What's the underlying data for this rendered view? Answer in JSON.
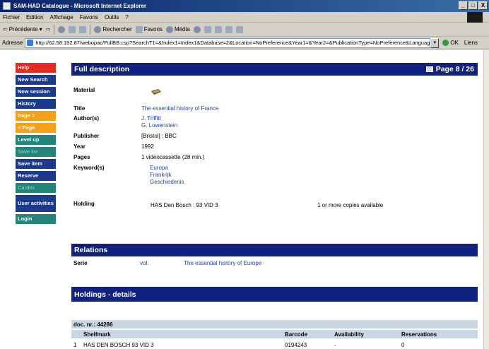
{
  "window": {
    "title": "SAM-HAD Catalogue - Microsoft Internet Explorer",
    "controls": [
      "_",
      "□",
      "X"
    ]
  },
  "menu": [
    "Fichier",
    "Edition",
    "Affichage",
    "Favoris",
    "Outils",
    "?"
  ],
  "toolbar": {
    "back": "Précédente",
    "search": "Rechercher",
    "favorites": "Favoris",
    "media": "Média"
  },
  "address": {
    "label": "Adresse",
    "url": "http://62.58.192.87/webopac/FullBB.csp?SearchT1=&Index1=Index1&Database=2&Location=NoPreference&Year1=&Year2=&PublicationType=NoPreference&Language=NoPr",
    "go": "OK",
    "links": "Liens"
  },
  "sidebar": [
    {
      "label": "Help",
      "style": "red"
    },
    {
      "label": "New Search",
      "style": "navy"
    },
    {
      "label": "New session",
      "style": "navy"
    },
    {
      "label": "History",
      "style": "navy"
    },
    {
      "label": "Page >",
      "style": "orange"
    },
    {
      "label": "< Page",
      "style": "orange"
    },
    {
      "label": "Level up",
      "style": "teal"
    },
    {
      "label": "Save list",
      "style": "teal-dim"
    },
    {
      "label": "Save item",
      "style": "navy"
    },
    {
      "label": "Reserve",
      "style": "navy"
    },
    {
      "label": "Cardex",
      "style": "teal-dim"
    },
    {
      "label": "User activities",
      "style": "navy"
    },
    {
      "label": "Login",
      "style": "teal"
    }
  ],
  "full_description": {
    "heading": "Full description",
    "page_indicator": "Page 8 / 26",
    "material_label": "Material",
    "material_icon": "videocassette-icon",
    "title_label": "Title",
    "title": "The essential history of France",
    "authors_label": "Author(s)",
    "authors": [
      "J. Triffitt",
      "G. Lowenstein"
    ],
    "publisher_label": "Publisher",
    "publisher": "[Bristol] : BBC",
    "year_label": "Year",
    "year": "1992",
    "pages_label": "Pages",
    "pages": "1 videocassette (28 min.)",
    "keywords_label": "Keyword(s)",
    "keywords": [
      "Europa",
      "Frankrijk",
      "Geschiedenis"
    ],
    "holding_label": "Holding",
    "holding_location": "HAS Den Bosch : 93 VID 3",
    "holding_status": "1 or more copies available"
  },
  "relations": {
    "heading": "Relations",
    "serie_label": "Serie",
    "vol": "vol.",
    "serie_title": "The essential history of Europe"
  },
  "holdings": {
    "heading": "Holdings - details",
    "doc_nr": "doc. nr.: 44286",
    "columns": [
      "Shelfmark",
      "Barcode",
      "Availability",
      "Reservations"
    ],
    "rows": [
      {
        "n": "1",
        "shelfmark": "HAS DEN BOSCH 93 VID 3",
        "barcode": "0194243",
        "availability": "-",
        "reservations": "0"
      }
    ]
  },
  "colors": {
    "header_bar": "#10227d",
    "help": "#e52a22",
    "nav_navy": "#1c3a8c",
    "nav_orange": "#f6a01a",
    "nav_teal": "#21857a",
    "link": "#1f3fbf",
    "table_header": "#c9d6e6"
  }
}
